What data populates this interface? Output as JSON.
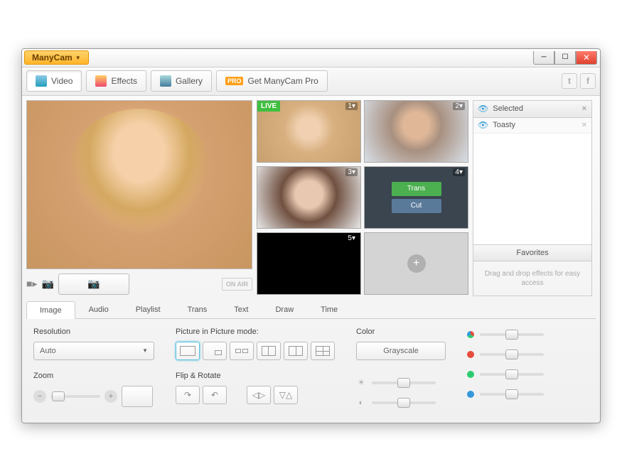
{
  "app": {
    "name": "ManyCam"
  },
  "toolbar": {
    "video": "Video",
    "effects": "Effects",
    "gallery": "Gallery",
    "pro_badge": "PRO",
    "get_pro": "Get ManyCam Pro"
  },
  "preview": {
    "onair": "ON AIR"
  },
  "tiles": {
    "live": "LIVE",
    "n1": "1▾",
    "n2": "2▾",
    "n3": "3▾",
    "n4": "4▾",
    "n5": "5▾",
    "trans": "Trans",
    "cut": "Cut"
  },
  "side": {
    "selected": "Selected",
    "effect1": "Toasty",
    "favorites": "Favorites",
    "fav_hint": "Drag and drop effects for easy access"
  },
  "tabs": {
    "image": "Image",
    "audio": "Audio",
    "playlist": "Playlist",
    "trans": "Trans",
    "text": "Text",
    "draw": "Draw",
    "time": "Time"
  },
  "settings": {
    "resolution_label": "Resolution",
    "resolution_value": "Auto",
    "zoom_label": "Zoom",
    "pip_label": "Picture in Picture mode:",
    "flip_label": "Flip & Rotate",
    "color_label": "Color",
    "grayscale": "Grayscale"
  }
}
